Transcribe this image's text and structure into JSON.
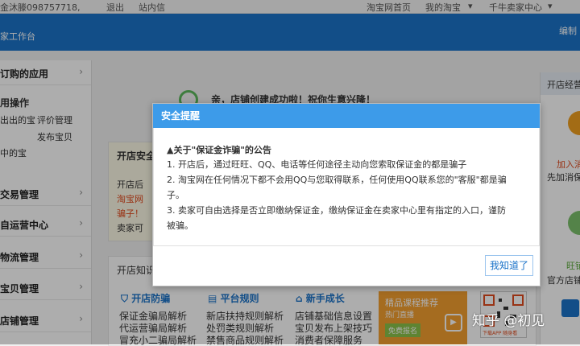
{
  "topbar": {
    "account": "金沐滕098757718,",
    "logout": "退出",
    "messages": "站内信",
    "taobao_home": "淘宝网首页",
    "my_taobao": "我的淘宝",
    "seller_center": "千牛卖家中心"
  },
  "header": {
    "title": "家工作台",
    "right_text": "编制"
  },
  "sidebar": {
    "apps_title": "订购的应用",
    "ops_title": "用操作",
    "ops_items": [
      "出出的宝",
      "评价管理",
      "发布宝贝",
      "中的宝"
    ],
    "menu": [
      {
        "label": "交易管理"
      },
      {
        "label": "自运营中心"
      },
      {
        "label": "物流管理"
      },
      {
        "label": "宝贝管理"
      },
      {
        "label": "店铺管理"
      }
    ]
  },
  "main": {
    "success_msg": "亲，店铺创建成功啦！祝你生意兴隆！",
    "security_title": "开店安全",
    "security_items": [
      "开店后",
      "淘宝网",
      "骗子！",
      "卖家可"
    ],
    "knowledge_title": "开店知识",
    "columns": [
      {
        "title": "开店防骗",
        "items": [
          "保证金骗局解析",
          "代运营骗局解析",
          "冒充小二骗局解析"
        ]
      },
      {
        "title": "平台规则",
        "items": [
          "新店扶持规则解析",
          "处罚类规则解析",
          "禁售商品规则解析"
        ]
      },
      {
        "title": "新手成长",
        "items": [
          "店铺基础信息设置",
          "宝贝发布上架技巧",
          "消费者保障服务"
        ]
      }
    ],
    "banner": {
      "title": "精品课程推荐",
      "subtitle": "热门直播",
      "button": "免费报名"
    },
    "qr_caption": "下载APP 随身看"
  },
  "right_panel": {
    "title": "开店经营",
    "join_label": "加入消",
    "join_desc": "先加消保",
    "wang_label": "旺铺",
    "official_label": "官方店铺"
  },
  "dialog": {
    "title": "安全提醒",
    "heading": "▲关于\"保证金诈骗\"的公告",
    "lines": [
      "1. 开店后，通过旺旺、QQ、电话等任何途径主动向您索取保证金的都是骗子",
      "2. 淘宝网在任何情况下都不会用QQ与您取得联系，任何使用QQ联系您的\"客服\"都是骗",
      "子。",
      "3. 卖家可自由选择是否立即缴纳保证金，缴纳保证金在卖家中心里有指定的入口，谨防",
      "被骗。"
    ],
    "ok_label": "我知道了"
  },
  "watermark": "知乎 @初见"
}
